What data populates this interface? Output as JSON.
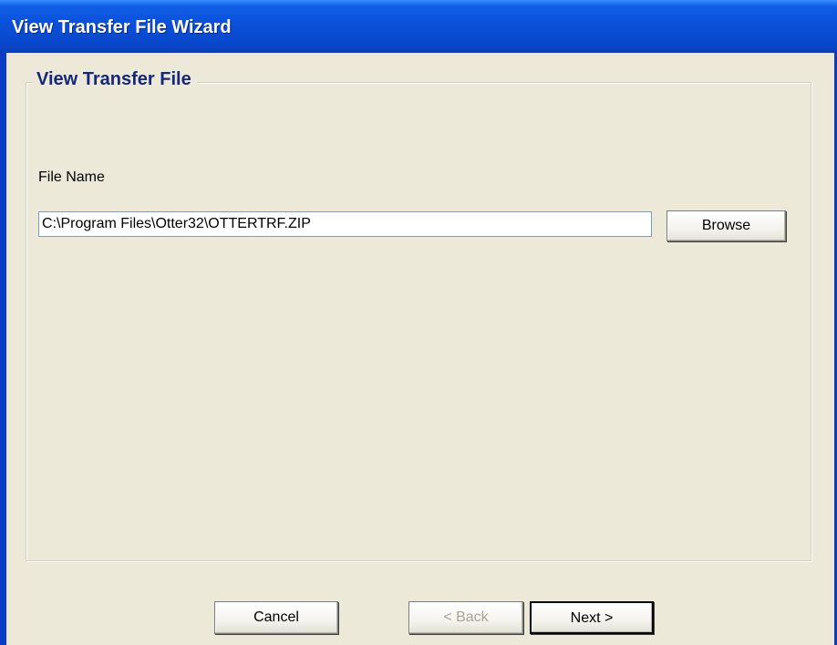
{
  "window": {
    "title": "View Transfer File Wizard"
  },
  "group": {
    "legend": "View Transfer File"
  },
  "file": {
    "label": "File Name",
    "value": "C:\\Program Files\\Otter32\\OTTERTRF.ZIP"
  },
  "buttons": {
    "browse": "Browse",
    "cancel": "Cancel",
    "back": "< Back",
    "next": "Next >"
  },
  "colors": {
    "title_bar": "#0a4fd8",
    "face": "#ece9d8",
    "legend_text": "#15287a"
  }
}
